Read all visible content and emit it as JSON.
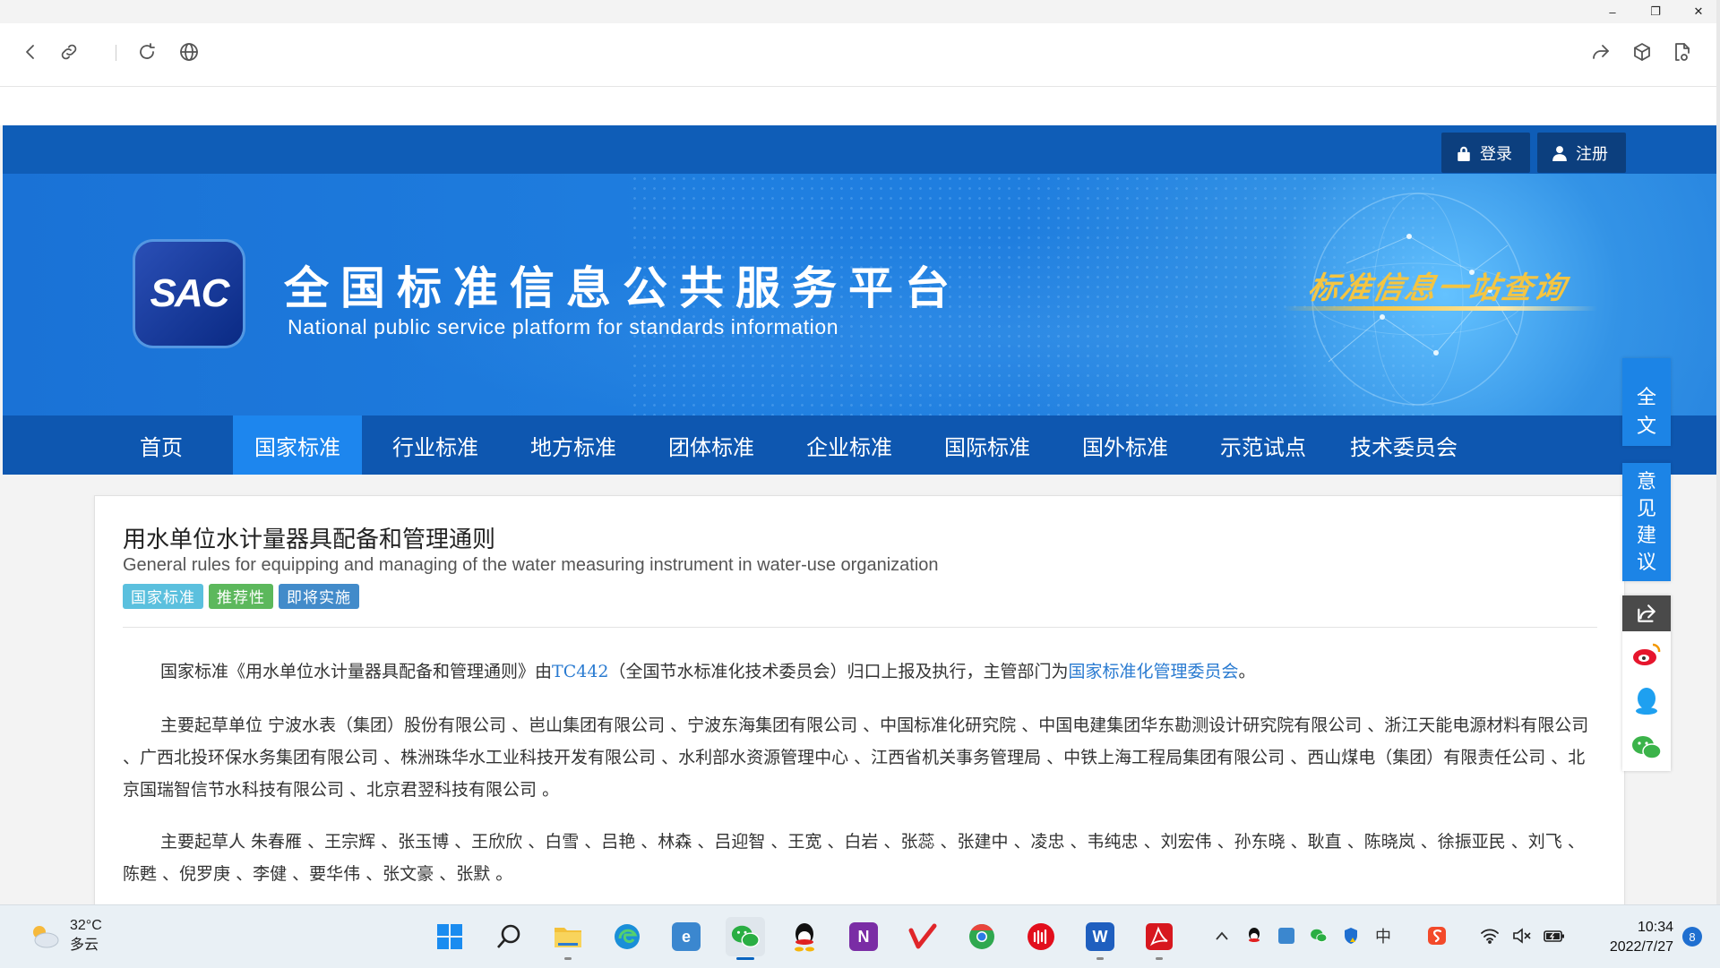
{
  "window": {
    "minimize": "–",
    "restore": "❐",
    "close": "✕"
  },
  "browser": {
    "icons": [
      "back-icon",
      "link-icon",
      "reload-icon",
      "globe-icon",
      "share-icon",
      "package-icon",
      "reader-icon"
    ]
  },
  "header": {
    "login": "登录",
    "register": "注册",
    "logo_text": "SAC",
    "title": "全国标准信息公共服务平台",
    "subtitle": "National public service platform  for standards information",
    "slogan": "标准信息一站查询"
  },
  "nav": {
    "items": [
      "首页",
      "国家标准",
      "行业标准",
      "地方标准",
      "团体标准",
      "企业标准",
      "国际标准",
      "国外标准",
      "示范试点",
      "技术委员会"
    ],
    "active_index": 1
  },
  "standard": {
    "title_cn": "用水单位水计量器具配备和管理通则",
    "title_en": "General rules for equipping and managing of the water measuring instrument in water-use organization",
    "tags": [
      "国家标准",
      "推荐性",
      "即将实施"
    ],
    "p1_prefix": "国家标准《用水单位水计量器具配备和管理通则》由",
    "p1_tc": "TC442",
    "p1_mid": "（全国节水标准化技术委员会）归口上报及执行，主管部门为",
    "p1_dept": "国家标准化管理委员会",
    "p1_suffix": "。",
    "p2": "主要起草单位 宁波水表（集团）股份有限公司 、岜山集团有限公司 、宁波东海集团有限公司 、中国标准化研究院 、中国电建集团华东勘测设计研究院有限公司 、浙江天能电源材料有限公司 、广西北投环保水务集团有限公司 、株洲珠华水工业科技开发有限公司 、水利部水资源管理中心 、江西省机关事务管理局 、中铁上海工程局集团有限公司 、西山煤电（集团）有限责任公司 、北京国瑞智信节水科技有限公司 、北京君翌科技有限公司 。",
    "p3": "主要起草人 朱春雁 、王宗辉 、张玉博 、王欣欣 、白雪 、吕艳 、林森 、吕迎智 、王宽 、白岩 、张蕊 、张建中 、凌忠 、韦纯忠 、刘宏伟 、孙东晓 、耿直 、陈晓岚 、徐振亚民 、刘飞 、陈甦 、倪罗庚 、李健 、要华伟 、张文豪 、张默 。"
  },
  "side_widgets": {
    "fulltext": [
      "全",
      "文"
    ],
    "feedback": [
      "意",
      "见",
      "建",
      "议"
    ],
    "share_icons": [
      "share-icon",
      "weibo-icon",
      "qq-icon",
      "wechat-icon"
    ]
  },
  "taskbar": {
    "weather_temp": "32°C",
    "weather_desc": "多云",
    "apps": [
      "start-icon",
      "search-icon",
      "file-explorer-icon",
      "edge-icon",
      "ie-icon",
      "wechat-icon",
      "qq-icon",
      "onenote-icon",
      "app-v-icon",
      "chrome-icon",
      "netease-music-icon",
      "word-icon",
      "acrobat-icon"
    ],
    "onenote_label": "N",
    "word_label": "W",
    "tray_ime": "中",
    "time": "10:34",
    "date": "2022/7/27",
    "notifications": "8"
  }
}
